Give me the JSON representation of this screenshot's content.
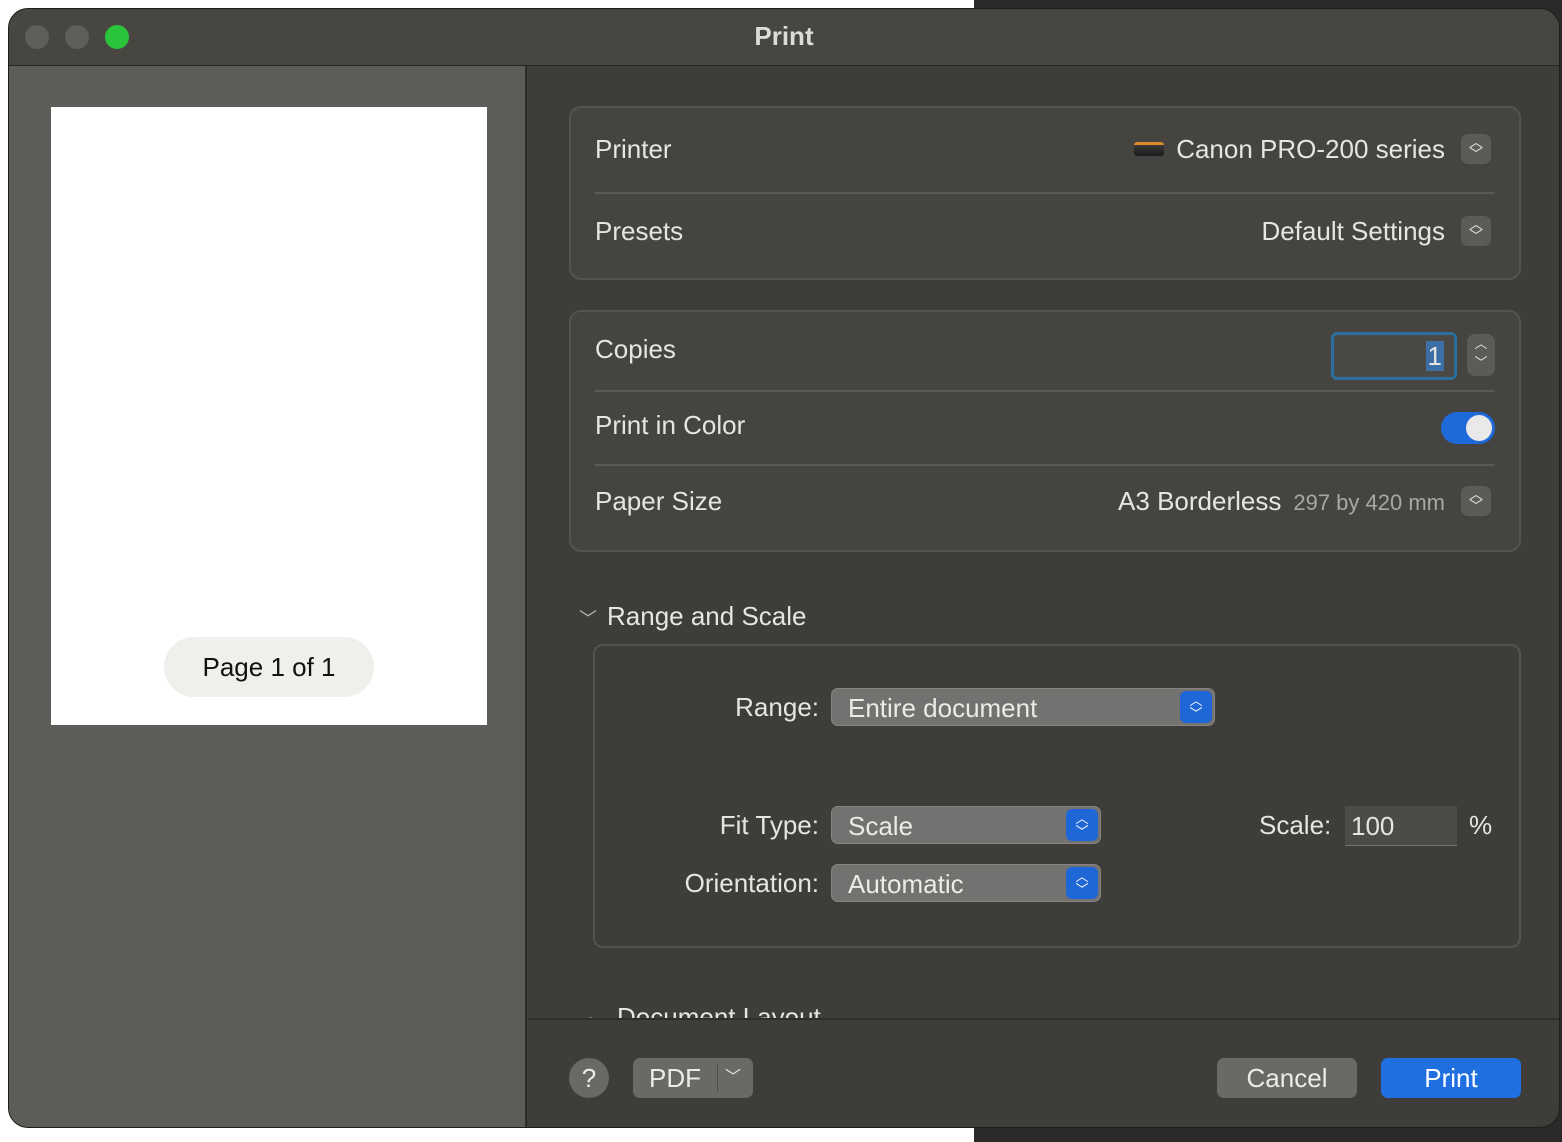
{
  "window": {
    "title": "Print"
  },
  "preview": {
    "page_indicator": "Page 1 of 1"
  },
  "printer": {
    "label": "Printer",
    "value": "Canon PRO-200 series"
  },
  "presets": {
    "label": "Presets",
    "value": "Default Settings"
  },
  "copies": {
    "label": "Copies",
    "value": "1"
  },
  "print_in_color": {
    "label": "Print in Color",
    "enabled": true
  },
  "paper_size": {
    "label": "Paper Size",
    "value": "A3 Borderless",
    "dimensions": "297 by 420 mm"
  },
  "range_and_scale": {
    "header": "Range and Scale",
    "range_label": "Range:",
    "range_value": "Entire document",
    "fit_type_label": "Fit Type:",
    "fit_type_value": "Scale",
    "orientation_label": "Orientation:",
    "orientation_value": "Automatic",
    "scale_label": "Scale:",
    "scale_value": "100",
    "scale_unit": "%"
  },
  "next_section": {
    "header": "Document Layout"
  },
  "footer": {
    "help": "?",
    "pdf": "PDF",
    "cancel": "Cancel",
    "print": "Print"
  },
  "colors": {
    "accent": "#1f6fe0",
    "toggle_on": "#1e6ad9",
    "close_traffic": "#2ac43b"
  }
}
